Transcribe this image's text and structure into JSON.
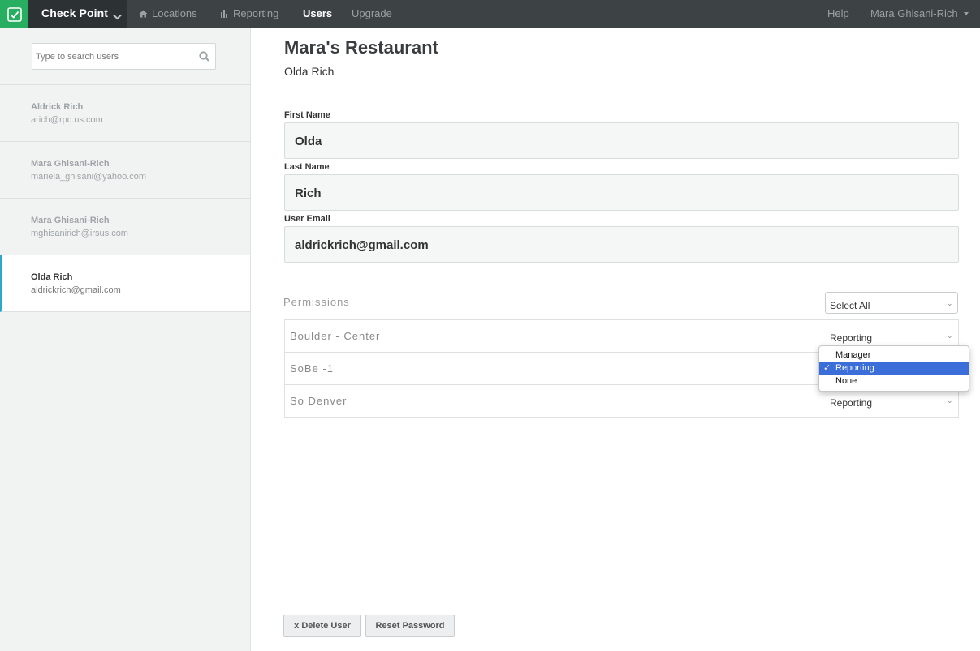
{
  "nav": {
    "brand": "Check Point",
    "items": [
      {
        "label": "Locations",
        "icon": "home-icon"
      },
      {
        "label": "Reporting",
        "icon": "bar-chart-icon"
      },
      {
        "label": "Users"
      },
      {
        "label": "Upgrade"
      }
    ],
    "help": "Help",
    "user_menu": "Mara Ghisani-Rich"
  },
  "sidebar": {
    "search_placeholder": "Type to search users",
    "users": [
      {
        "name": "Aldrick Rich",
        "email": "arich@rpc.us.com"
      },
      {
        "name": "Mara Ghisani-Rich",
        "email": "mariela_ghisani@yahoo.com"
      },
      {
        "name": "Mara Ghisani-Rich",
        "email": "mghisanirich@irsus.com"
      },
      {
        "name": "Olda Rich",
        "email": "aldrickrich@gmail.com"
      }
    ]
  },
  "main": {
    "title": "Mara's Restaurant",
    "subtitle": "Olda Rich",
    "fields": {
      "first_name_label": "First Name",
      "first_name": "Olda",
      "last_name_label": "Last Name",
      "last_name": "Rich",
      "email_label": "User Email",
      "email": "aldrickrich@gmail.com"
    },
    "permissions": {
      "label": "Permissions",
      "select_all": "Select All",
      "rows": [
        {
          "location": "Boulder - Center",
          "role": "Reporting"
        },
        {
          "location": "SoBe -1",
          "role": "Reporting"
        },
        {
          "location": "So Denver",
          "role": "Reporting"
        }
      ]
    },
    "dropdown": {
      "options": [
        "Manager",
        "Reporting",
        "None"
      ],
      "selected": "Reporting",
      "check": "✓"
    }
  },
  "footer": {
    "delete_label": "x Delete User",
    "reset_label": "Reset Password"
  },
  "colors": {
    "nav_bg": "#3d4244",
    "brand_green": "#27ae60",
    "accent": "#2fa7c7",
    "dropdown_highlight": "#3b6ed9"
  }
}
